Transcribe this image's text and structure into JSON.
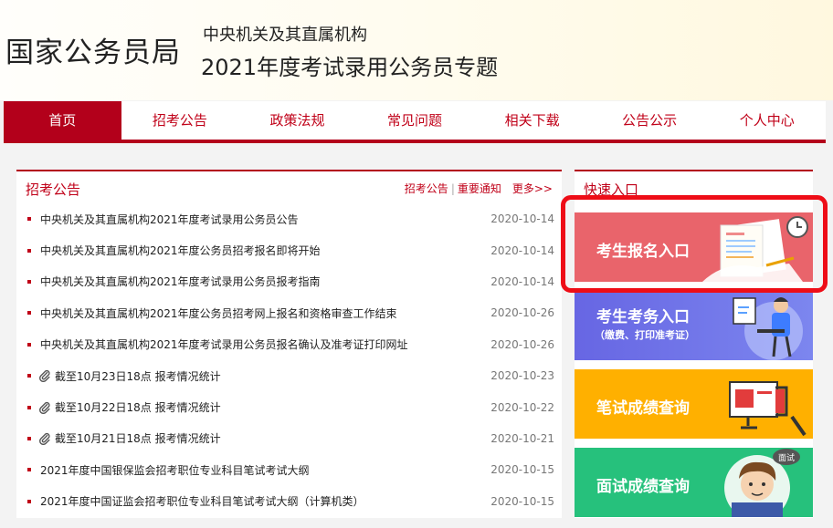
{
  "header": {
    "org_name": "国家公务员局",
    "subtitle_line1": "中央机关及其直属机构",
    "subtitle_line2": "2021年度考试录用公务员专题"
  },
  "nav": {
    "items": [
      "首页",
      "招考公告",
      "政策法规",
      "常见问题",
      "相关下载",
      "公告公示",
      "个人中心"
    ]
  },
  "announcements": {
    "title": "招考公告",
    "link_1": "招考公告",
    "separator": "|",
    "link_2": "重要通知",
    "more": "更多>>",
    "items": [
      {
        "title": "中央机关及其直属机构2021年度考试录用公务员公告",
        "date": "2020-10-14",
        "icon": "bullet"
      },
      {
        "title": "中央机关及其直属机构2021年度公务员招考报名即将开始",
        "date": "2020-10-14",
        "icon": "bullet"
      },
      {
        "title": "中央机关及其直属机构2021年度考试录用公务员报考指南",
        "date": "2020-10-14",
        "icon": "bullet"
      },
      {
        "title": "中央机关及其直属机构2021年度公务员招考网上报名和资格审查工作结束",
        "date": "2020-10-26",
        "icon": "bullet"
      },
      {
        "title": "中央机关及其直属机构2021年度考试录用公务员报名确认及准考证打印网址",
        "date": "2020-10-26",
        "icon": "bullet"
      },
      {
        "title": "截至10月23日18点 报考情况统计",
        "date": "2020-10-23",
        "icon": "paperclip-icon"
      },
      {
        "title": "截至10月22日18点 报考情况统计",
        "date": "2020-10-22",
        "icon": "paperclip-icon"
      },
      {
        "title": "截至10月21日18点 报考情况统计",
        "date": "2020-10-21",
        "icon": "paperclip-icon"
      },
      {
        "title": "2021年度中国银保监会招考职位专业科目笔试考试大纲",
        "date": "2020-10-15",
        "icon": "bullet"
      },
      {
        "title": "2021年度中国证监会招考职位专业科目笔试考试大纲（计算机类）",
        "date": "2020-10-15",
        "icon": "bullet"
      }
    ]
  },
  "quick_entry": {
    "title": "快速入口",
    "buttons": [
      {
        "label": "考生报名入口",
        "sublabel": "",
        "color": "#e9646b",
        "art": "registration-form-icon"
      },
      {
        "label": "考生考务入口",
        "sublabel": "（缴费、打印准考证）",
        "color": "#6e6fe6",
        "art": "person-at-desk-icon"
      },
      {
        "label": "笔试成绩查询",
        "sublabel": "",
        "color": "#ffb000",
        "art": "monitor-icon"
      },
      {
        "label": "面试成绩查询",
        "sublabel": "",
        "color": "#26c17c",
        "art": "interview-avatar-icon"
      }
    ]
  },
  "colors": {
    "brand_red": "#b3001b",
    "highlight_red": "#ee0d17"
  }
}
